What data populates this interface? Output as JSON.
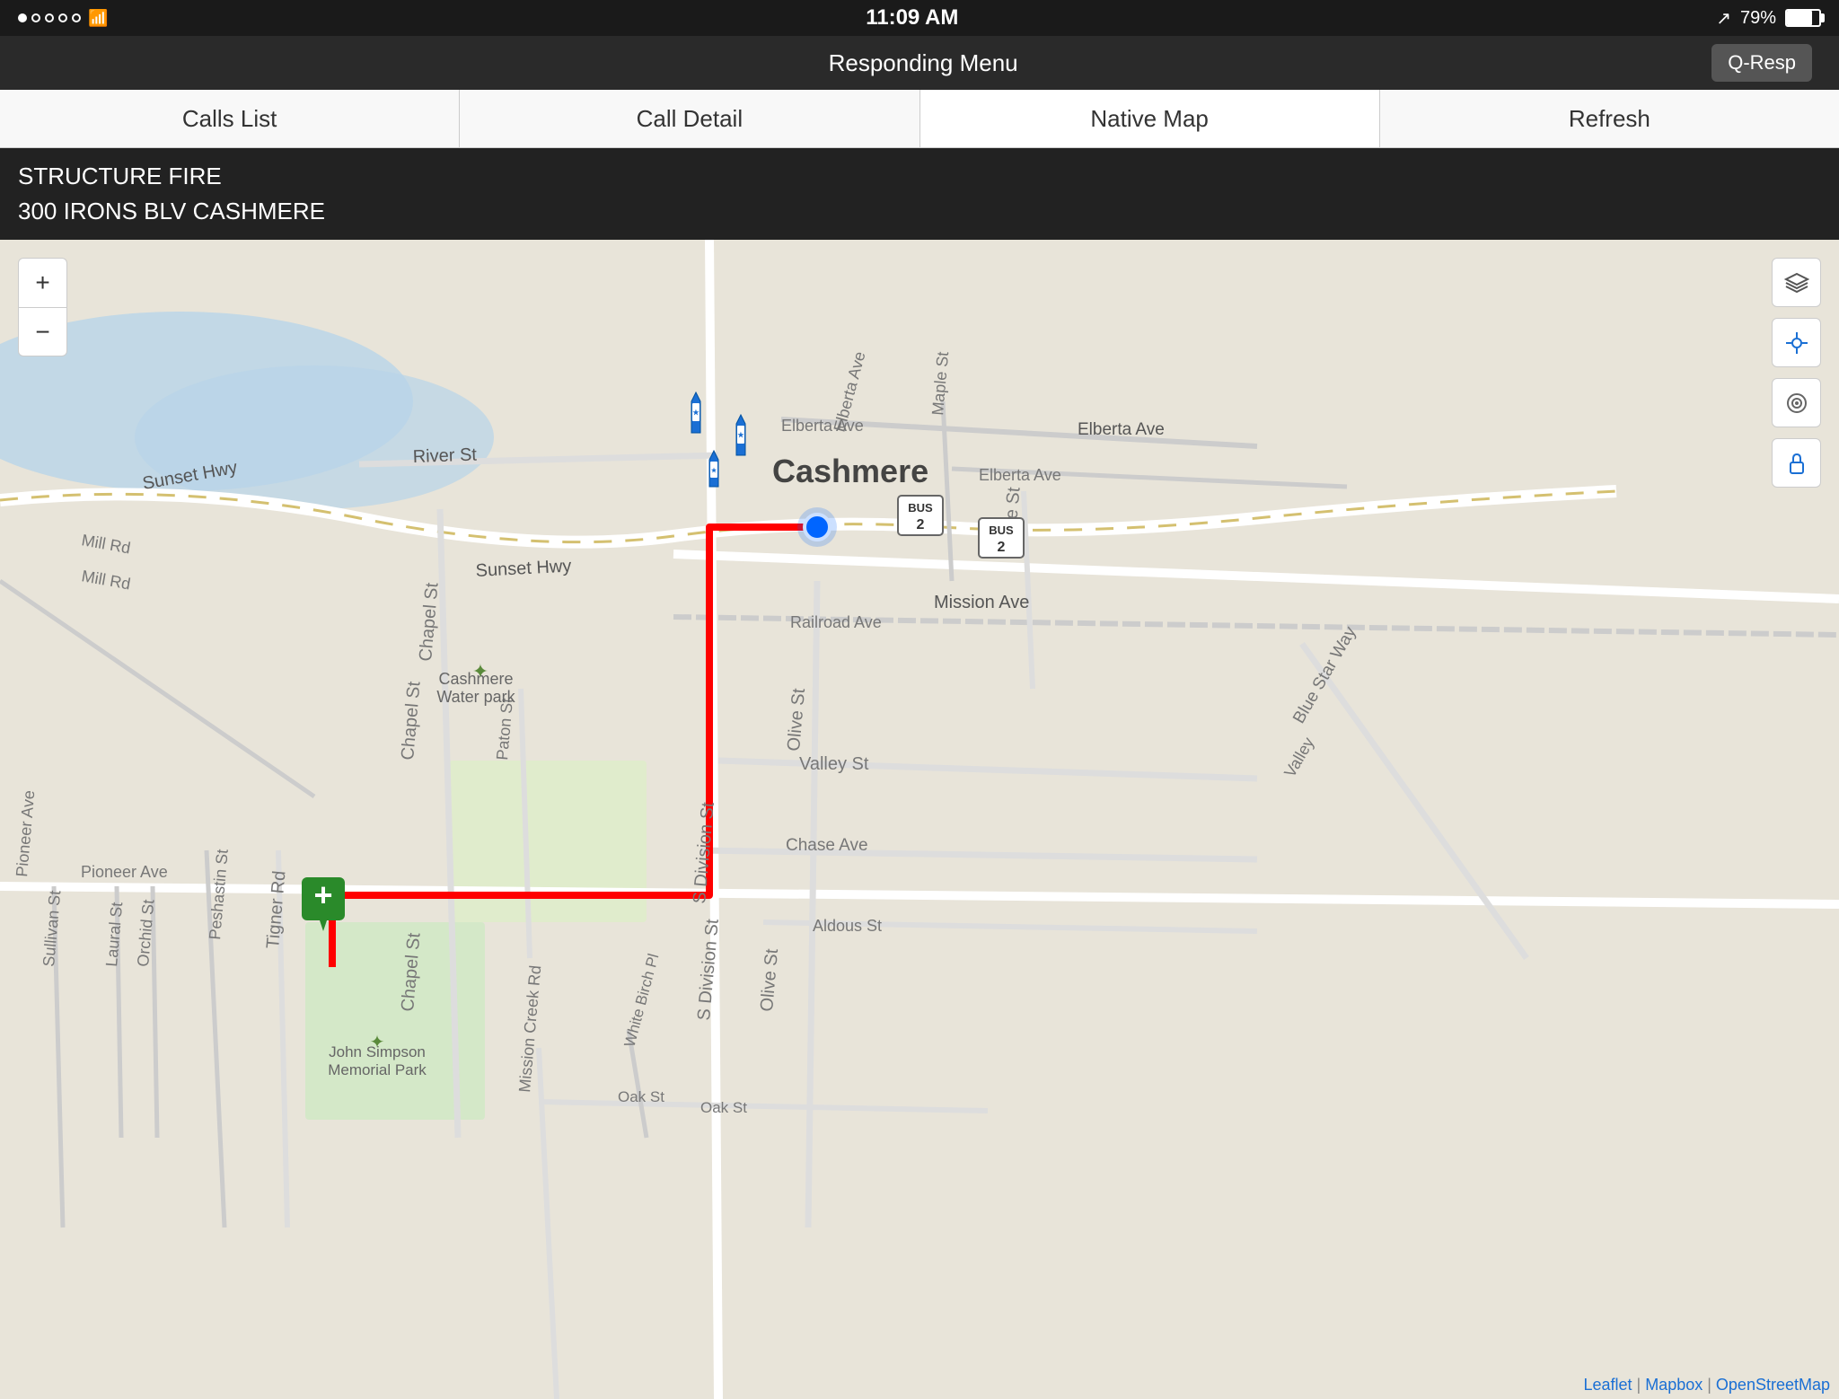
{
  "status_bar": {
    "time": "11:09 AM",
    "battery": "79%",
    "signal_dots": 5,
    "filled_dots": 1
  },
  "top_nav": {
    "title": "Responding Menu",
    "q_resp_label": "Q-Resp"
  },
  "tabs": [
    {
      "id": "calls-list",
      "label": "Calls List",
      "active": false
    },
    {
      "id": "call-detail",
      "label": "Call Detail",
      "active": false
    },
    {
      "id": "native-map",
      "label": "Native Map",
      "active": true
    },
    {
      "id": "refresh",
      "label": "Refresh",
      "active": false
    }
  ],
  "incident": {
    "type": "STRUCTURE FIRE",
    "address": "300 IRONS BLV CASHMERE"
  },
  "map": {
    "zoom_in": "+",
    "zoom_out": "−",
    "attribution": "Leaflet | Mapbox | OpenStreetMap"
  },
  "map_labels": {
    "cashmere": "Cashmere",
    "river_st": "River St",
    "sunset_hwy": "Sunset Hwy",
    "mission_ave": "Mission Ave",
    "railroad_ave": "Railroad Ave",
    "pioneer_ave": "Pioneer Ave",
    "valley_st": "Valley St",
    "chase_ave": "Chase Ave",
    "aldous_st": "Aldous St",
    "olive_st": "Olive St",
    "chapel_st": "Chapel St",
    "paton_st": "Paton St",
    "mill_rd": "Mill Rd",
    "cashmere_water_park": "Cashmere\nWater park",
    "john_simpson": "John Simpson\nMemorial Park",
    "elberta_ave": "Elberta Ave",
    "vine_st": "Vine St",
    "bus_2": "BUS\n2",
    "white_birch_pl": "White Birch Pl",
    "mission_creek_rd": "Mission Creek Rd",
    "s_division_st": "S Division St",
    "oak_st": "Oak St",
    "orchid_st": "Orchid St",
    "laural_st": "Laural St",
    "sullivan_st": "Sullivan St",
    "peshastin_st": "Peshastin St",
    "tigner_rd": "Tigner Rd",
    "maple_st": "Maple St",
    "blue_star_way": "Blue Star Way"
  }
}
